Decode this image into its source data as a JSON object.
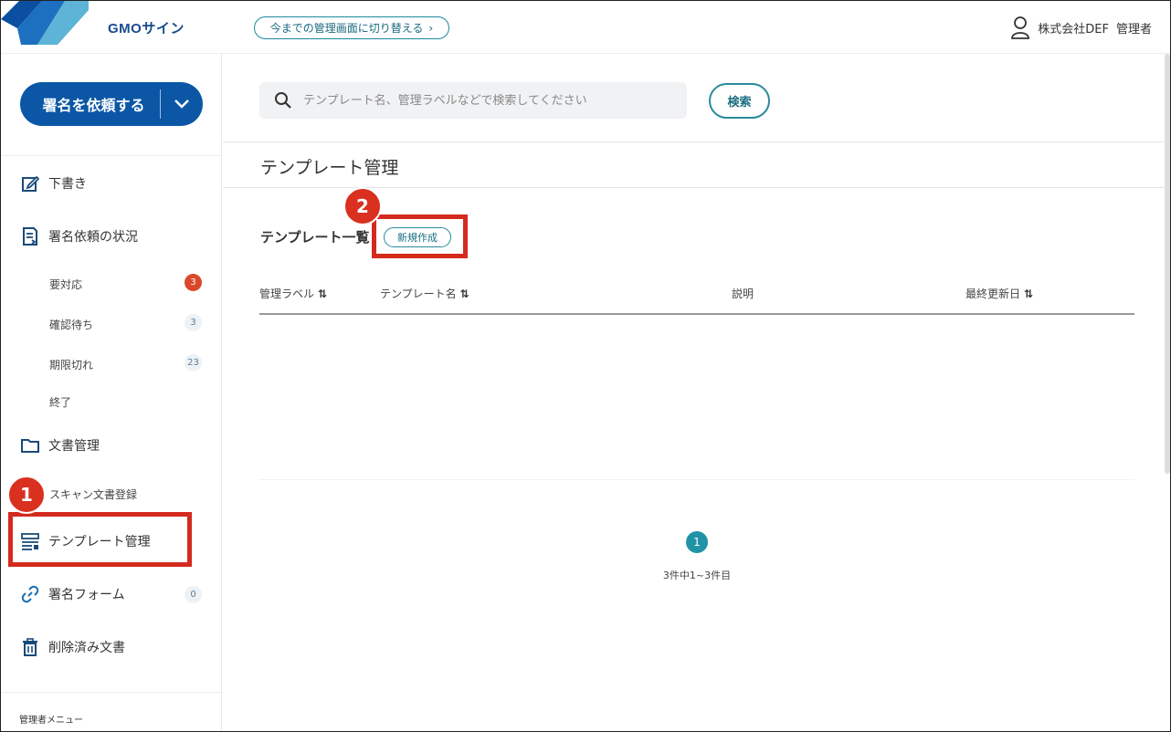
{
  "header": {
    "logo_text": "GMOサイン",
    "switch_label": "今までの管理画面に切り替える",
    "company": "株式会社DEF",
    "role": "管理者"
  },
  "sidebar": {
    "request_button": "署名を依頼する",
    "items": [
      {
        "label": "下書き",
        "icon": "edit-icon"
      },
      {
        "label": "署名依頼の状況",
        "icon": "document-list-icon"
      },
      {
        "label": "文書管理",
        "icon": "folder-icon"
      },
      {
        "label": "テンプレート管理",
        "icon": "template-icon"
      },
      {
        "label": "署名フォーム",
        "icon": "link-icon"
      },
      {
        "label": "削除済み文書",
        "icon": "trash-icon"
      }
    ],
    "status_sub": [
      {
        "label": "要対応",
        "count": "3"
      },
      {
        "label": "確認待ち",
        "count": "3"
      },
      {
        "label": "期限切れ",
        "count": "23"
      },
      {
        "label": "終了"
      }
    ],
    "doc_sub": [
      {
        "label": "スキャン文書登録"
      }
    ],
    "form_count": "0",
    "admin_menu": "管理者メニュー"
  },
  "search": {
    "placeholder": "テンプレート名、管理ラベルなどで検索してください",
    "button": "検索"
  },
  "main": {
    "page_title": "テンプレート管理",
    "list_title": "テンプレート一覧",
    "new_button": "新規作成",
    "columns": [
      "管理ラベル",
      "テンプレート名",
      "説明",
      "最終更新日"
    ],
    "pagination": {
      "current": "1",
      "info": "3件中1~3件目"
    }
  },
  "annotations": {
    "step1": "1",
    "step2": "2",
    "color": "#d42a1e"
  }
}
